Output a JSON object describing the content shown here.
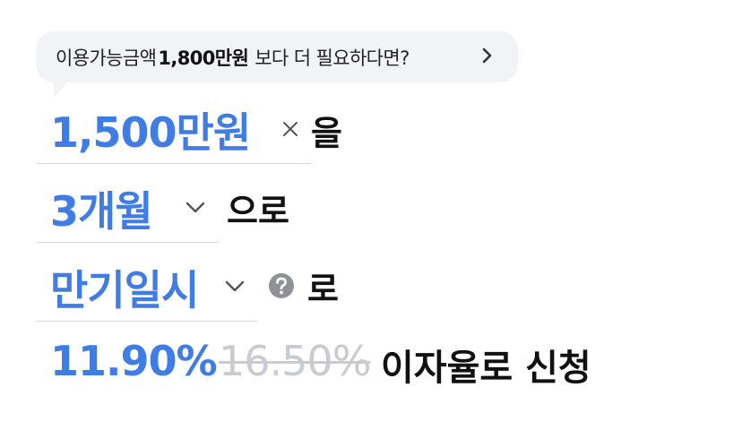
{
  "banner": {
    "prefix": "이용가능금액",
    "amount": "1,800만원",
    "suffix": "보다 더 필요하다면?"
  },
  "amount_field": {
    "value": "1,500만원",
    "particle": "을"
  },
  "period_field": {
    "value": "3개월",
    "particle": "으로"
  },
  "repay_field": {
    "value": "만기일시",
    "particle": "로"
  },
  "rate": {
    "current": "11.90%",
    "original": "16.50%",
    "cta": "이자율로 신청"
  },
  "colors": {
    "accent": "#3f7de5",
    "bubble_bg": "#f2f3f6",
    "muted": "#c9cbd0"
  },
  "icons": [
    "chevron-right-icon",
    "clear-icon",
    "chevron-down-icon",
    "help-icon"
  ]
}
